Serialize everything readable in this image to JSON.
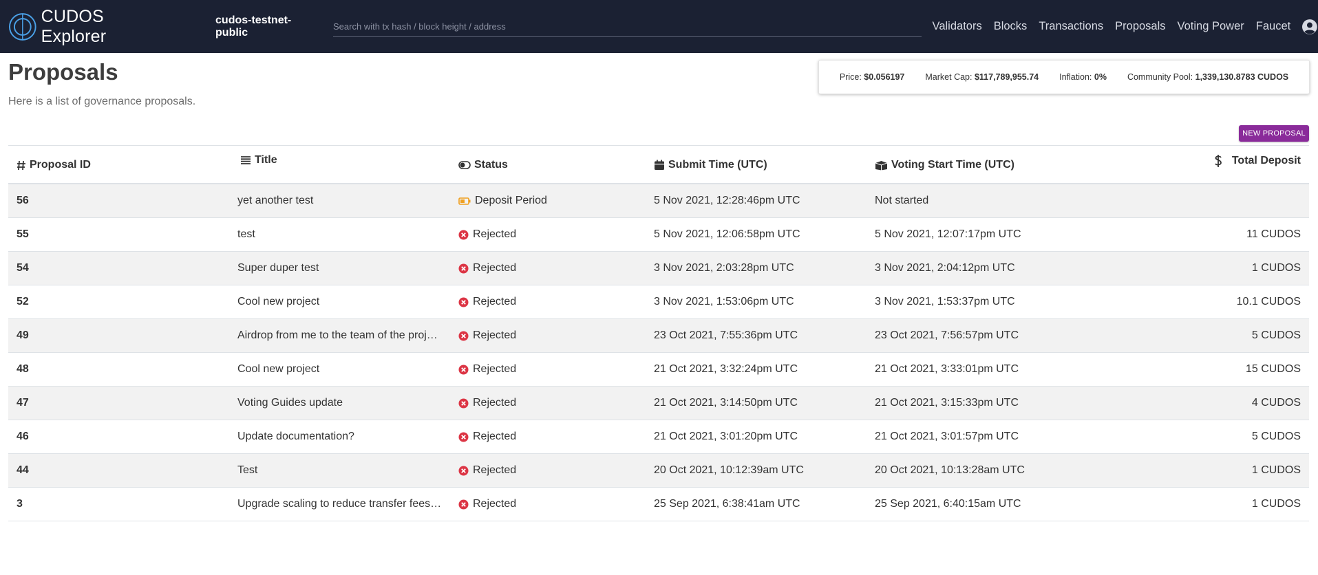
{
  "navbar": {
    "brand": "CUDOS Explorer",
    "network": "cudos-testnet-public",
    "search_placeholder": "Search with tx hash / block height / address",
    "links": [
      "Validators",
      "Blocks",
      "Transactions",
      "Proposals",
      "Voting Power",
      "Faucet"
    ],
    "account_icon": "account-circle-icon",
    "logo_icon": "cudos-logo-icon"
  },
  "page": {
    "title": "Proposals",
    "subtitle": "Here is a list of governance proposals.",
    "new_proposal_label": "NEW PROPOSAL"
  },
  "stats": {
    "price_label": "Price:",
    "price_value": "$0.056197",
    "market_cap_label": "Market Cap:",
    "market_cap_value": "$117,789,955.74",
    "inflation_label": "Inflation:",
    "inflation_value": "0%",
    "community_pool_label": "Community Pool:",
    "community_pool_value": "1,339,130.8783 CUDOS"
  },
  "table": {
    "headers": {
      "id": "Proposal ID",
      "title": "Title",
      "status": "Status",
      "submit_time": "Submit Time (UTC)",
      "voting_start": "Voting Start Time (UTC)",
      "deposit": "Total Deposit"
    },
    "header_icons": [
      "hash-icon",
      "list-icon",
      "toggle-icon",
      "calendar-icon",
      "box-icon",
      "dollar-icon"
    ],
    "rows": [
      {
        "id": "56",
        "title": "yet another test",
        "status": "Deposit Period",
        "status_icon": "deposit-battery-icon",
        "submit_time": "5 Nov 2021, 12:28:46pm UTC",
        "voting_start": "Not started",
        "deposit": ""
      },
      {
        "id": "55",
        "title": "test",
        "status": "Rejected",
        "status_icon": "rejected-icon",
        "submit_time": "5 Nov 2021, 12:06:58pm UTC",
        "voting_start": "5 Nov 2021, 12:07:17pm UTC",
        "deposit": "11 CUDOS"
      },
      {
        "id": "54",
        "title": "Super duper test",
        "status": "Rejected",
        "status_icon": "rejected-icon",
        "submit_time": "3 Nov 2021, 2:03:28pm UTC",
        "voting_start": "3 Nov 2021, 2:04:12pm UTC",
        "deposit": "1 CUDOS"
      },
      {
        "id": "52",
        "title": "Cool new project",
        "status": "Rejected",
        "status_icon": "rejected-icon",
        "submit_time": "3 Nov 2021, 1:53:06pm UTC",
        "voting_start": "3 Nov 2021, 1:53:37pm UTC",
        "deposit": "10.1 CUDOS"
      },
      {
        "id": "49",
        "title": "Airdrop from me to the team of the proj…",
        "status": "Rejected",
        "status_icon": "rejected-icon",
        "submit_time": "23 Oct 2021, 7:55:36pm UTC",
        "voting_start": "23 Oct 2021, 7:56:57pm UTC",
        "deposit": "5 CUDOS"
      },
      {
        "id": "48",
        "title": "Cool new project",
        "status": "Rejected",
        "status_icon": "rejected-icon",
        "submit_time": "21 Oct 2021, 3:32:24pm UTC",
        "voting_start": "21 Oct 2021, 3:33:01pm UTC",
        "deposit": "15 CUDOS"
      },
      {
        "id": "47",
        "title": "Voting Guides update",
        "status": "Rejected",
        "status_icon": "rejected-icon",
        "submit_time": "21 Oct 2021, 3:14:50pm UTC",
        "voting_start": "21 Oct 2021, 3:15:33pm UTC",
        "deposit": "4 CUDOS"
      },
      {
        "id": "46",
        "title": "Update documentation?",
        "status": "Rejected",
        "status_icon": "rejected-icon",
        "submit_time": "21 Oct 2021, 3:01:20pm UTC",
        "voting_start": "21 Oct 2021, 3:01:57pm UTC",
        "deposit": "5 CUDOS"
      },
      {
        "id": "44",
        "title": "Test",
        "status": "Rejected",
        "status_icon": "rejected-icon",
        "submit_time": "20 Oct 2021, 10:12:39am UTC",
        "voting_start": "20 Oct 2021, 10:13:28am UTC",
        "deposit": "1 CUDOS"
      },
      {
        "id": "3",
        "title": "Upgrade scaling to reduce transfer fees…",
        "status": "Rejected",
        "status_icon": "rejected-icon",
        "submit_time": "25 Sep 2021, 6:38:41am UTC",
        "voting_start": "25 Sep 2021, 6:40:15am UTC",
        "deposit": "1 CUDOS"
      }
    ]
  },
  "colors": {
    "navbar_bg": "#1b2133",
    "accent_purple": "#8a2b9a",
    "rejected_red": "#dc3545",
    "deposit_orange": "#f0a020",
    "row_stripe": "#f2f2f2"
  }
}
